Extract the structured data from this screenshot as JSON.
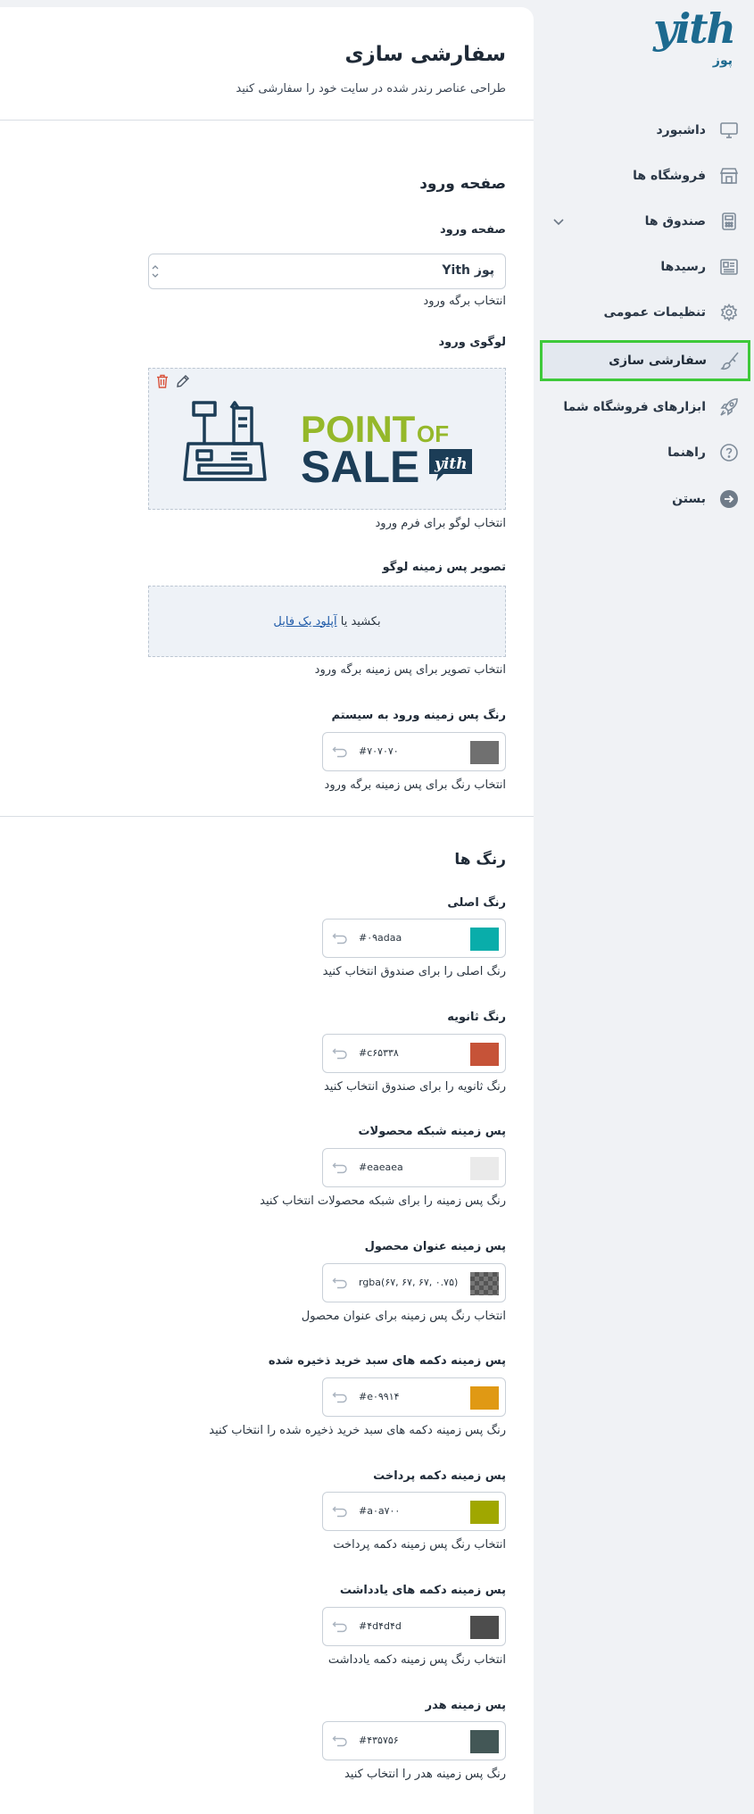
{
  "brand": {
    "logo_text": "yith",
    "sub_label": "پوز"
  },
  "sidebar": {
    "items": [
      {
        "label": "داشبورد",
        "icon": "monitor-icon"
      },
      {
        "label": "فروشگاه ها",
        "icon": "store-icon"
      },
      {
        "label": "صندوق ها",
        "icon": "register-icon",
        "has_chevron": true
      },
      {
        "label": "رسیدها",
        "icon": "receipt-icon"
      },
      {
        "label": "تنظیمات عمومی",
        "icon": "gear-icon"
      },
      {
        "label": "سفارشی سازی",
        "icon": "brush-icon",
        "active": true
      },
      {
        "label": "ابزارهای فروشگاه شما",
        "icon": "rocket-icon"
      },
      {
        "label": "راهنما",
        "icon": "help-icon"
      },
      {
        "label": "بستن",
        "icon": "close-arrow-icon"
      }
    ]
  },
  "page": {
    "title": "سفارشی سازی",
    "subtitle": "طراحی عناصر رندر شده در سایت خود را سفارشی کنید"
  },
  "login_section": {
    "title": "صفحه ورود",
    "login_page": {
      "label": "صفحه ورود",
      "value": "Yith پوز",
      "desc": "انتخاب برگه ورود"
    },
    "login_logo": {
      "label": "لوگوی ورود",
      "desc": "انتخاب لوگو برای فرم ورود",
      "logo_word1": "POINT",
      "logo_of": "OF",
      "logo_word2": "SALE",
      "logo_badge": "yith"
    },
    "logo_bg": {
      "label": "تصویر پس زمینه لوگو",
      "drop_text": "بکشید یا",
      "upload_link": "آپلود یک فایل",
      "desc": "انتخاب تصویر برای پس زمینه برگه ورود"
    },
    "login_bg_color": {
      "label": "رنگ پس زمینه ورود به سیستم",
      "hex": "#۷۰۷۰۷۰",
      "color": "#707070",
      "desc": "انتخاب رنگ برای پس زمینه برگه ورود"
    }
  },
  "colors_section": {
    "title": "رنگ ها",
    "fields": [
      {
        "label": "رنگ اصلی",
        "hex": "#۰۹adaa",
        "color": "#09adaa",
        "desc": "رنگ اصلی را برای صندوق انتخاب کنید"
      },
      {
        "label": "رنگ ثانویه",
        "hex": "#c۶۵۳۳۸",
        "color": "#c65338",
        "desc": "رنگ ثانویه را برای صندوق انتخاب کنید"
      },
      {
        "label": "پس زمینه شبکه محصولات",
        "hex": "#eaeaea",
        "color": "#eaeaea",
        "desc": "رنگ پس زمینه را برای شبکه محصولات انتخاب کنید"
      },
      {
        "label": "پس زمینه عنوان محصول",
        "hex": "rgba(۶۷, ۶۷, ۶۷, ۰.۷۵)",
        "color": "rgba(67,67,67,0.75)",
        "checker": true,
        "desc": "انتخاب رنگ پس زمینه برای عنوان محصول"
      },
      {
        "label": "پس زمینه دکمه های سبد خرید ذخیره شده",
        "hex": "#e۰۹۹۱۴",
        "color": "#e09914",
        "desc": "رنگ پس زمینه دکمه های سبد خرید ذخیره شده را انتخاب کنید"
      },
      {
        "label": "پس زمینه دکمه پرداخت",
        "hex": "#a۰a۷۰۰",
        "color": "#a0a700",
        "desc": "انتخاب رنگ پس زمینه دکمه پرداخت"
      },
      {
        "label": "پس زمینه دکمه های یادداشت",
        "hex": "#۴d۴d۴d",
        "color": "#4d4d4d",
        "desc": "انتخاب رنگ پس زمینه دکمه یادداشت"
      },
      {
        "label": "پس زمینه هدر",
        "hex": "#۴۳۵۷۵۶",
        "color": "#435756",
        "desc": "رنگ پس زمینه هدر را انتخاب کنید"
      }
    ]
  }
}
